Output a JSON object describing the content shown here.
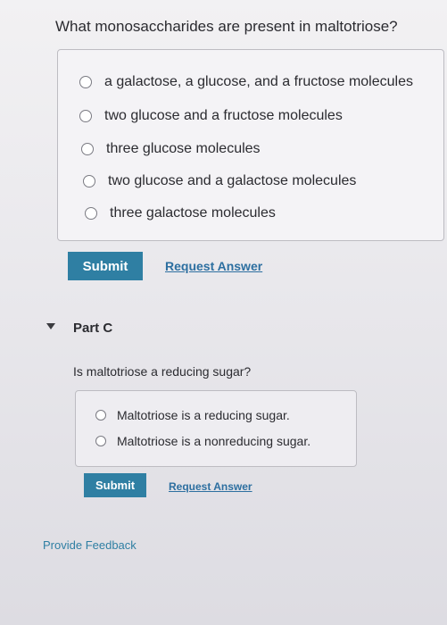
{
  "question": {
    "title": "What monosaccharides are present in maltotriose?",
    "options": [
      "a galactose, a glucose, and a fructose molecules",
      "two glucose and a fructose molecules",
      "three glucose molecules",
      "two glucose and a galactose molecules",
      "three galactose molecules"
    ],
    "submit_label": "Submit",
    "request_answer_label": "Request Answer"
  },
  "part_c": {
    "title": "Part C",
    "question": "Is maltotriose a reducing sugar?",
    "options": [
      "Maltotriose is a reducing sugar.",
      "Maltotriose is a nonreducing sugar."
    ],
    "submit_label": "Submit",
    "request_answer_label": "Request Answer"
  },
  "feedback_label": "Provide Feedback",
  "colors": {
    "button": "#2f7fa3",
    "link": "#2d6fa0"
  }
}
